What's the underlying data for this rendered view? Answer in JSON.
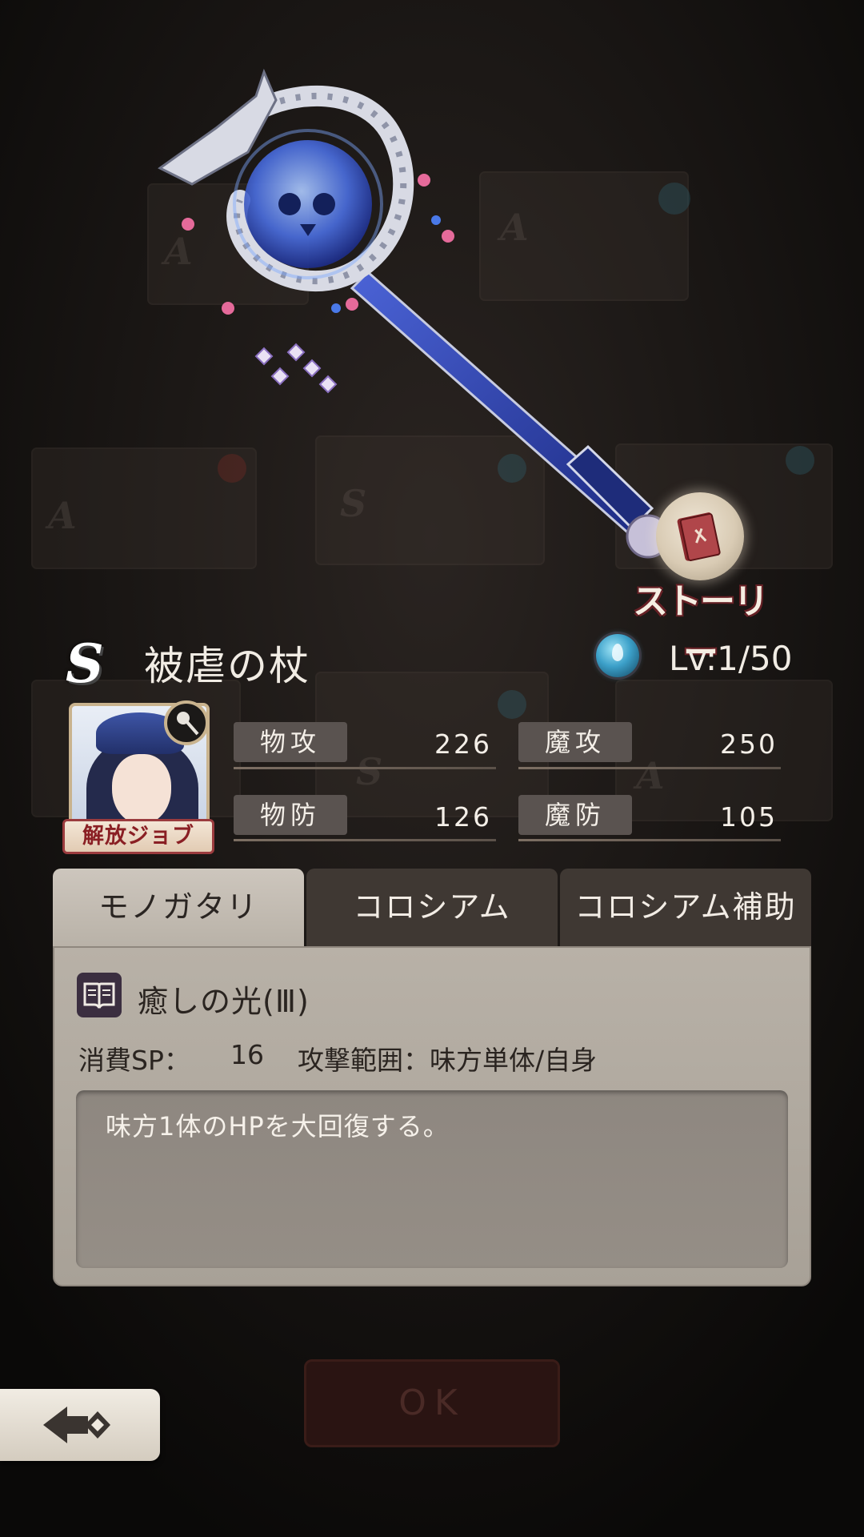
{
  "story_button": {
    "label": "ストーリー",
    "icon": "story-book-icon"
  },
  "weapon": {
    "rank": "S",
    "name": "被虐の杖",
    "element_icon": "water-element-icon",
    "level": "Lv:1/50"
  },
  "job": {
    "banner_label": "解放ジョブ",
    "weapon_type_icon": "staff-type-icon"
  },
  "stats": {
    "phys_atk": {
      "label": "物攻",
      "value": "226"
    },
    "mag_atk": {
      "label": "魔攻",
      "value": "250"
    },
    "phys_def": {
      "label": "物防",
      "value": "126"
    },
    "mag_def": {
      "label": "魔防",
      "value": "105"
    }
  },
  "tabs": [
    {
      "label": "モノガタリ",
      "active": true
    },
    {
      "label": "コロシアム",
      "active": false
    },
    {
      "label": "コロシアム補助",
      "active": false
    }
  ],
  "skill": {
    "icon": "book-icon",
    "name": "癒しの光(Ⅲ)",
    "sp_label": "消費SP：",
    "sp_value": "16",
    "range": "攻撃範囲：味方単体/自身",
    "description": "味方1体のHPを大回復する。"
  },
  "buttons": {
    "ok": "OK",
    "back_icon": "back-arrow-icon"
  },
  "colors": {
    "accent_red": "#8a1f24",
    "panel": "#b8b1a7",
    "tab_inactive": "#3f3833",
    "background": "#0c0a09"
  }
}
